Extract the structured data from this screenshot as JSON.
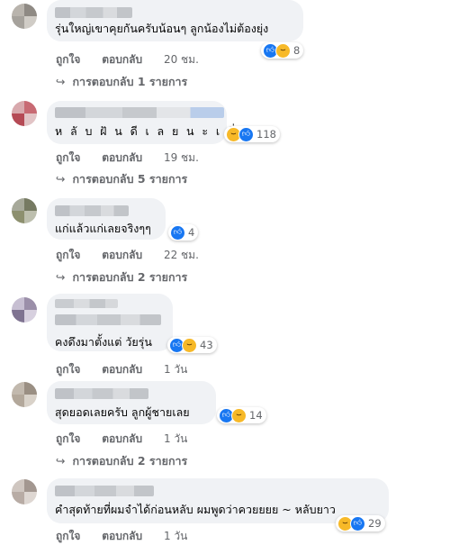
{
  "comments": [
    {
      "text": "รุ่นใหญ่เขาคุยกันครับน้อนๆ ลูกน้องไม่ต้องยุ่ง",
      "reaction_count": "8",
      "reactions": [
        "like-icon",
        "haha-icon"
      ],
      "like_label": "ถูกใจ",
      "reply_label": "ตอบกลับ",
      "time": "20 ชม.",
      "replies_label": "การตอบกลับ 1 รายการ",
      "reply_arrow": "↪"
    },
    {
      "text": "ห ลั บ ฝั น ดี เ ล ย น ะ เ นี่ ย",
      "reaction_count": "118",
      "reactions": [
        "haha-icon",
        "like-icon"
      ],
      "like_label": "ถูกใจ",
      "reply_label": "ตอบกลับ",
      "time": "19 ชม.",
      "replies_label": "การตอบกลับ 5 รายการ",
      "reply_arrow": "↪"
    },
    {
      "text": "แก่แล้วแก่เลยจริงๆๆ",
      "reaction_count": "4",
      "reactions": [
        "like-icon"
      ],
      "like_label": "ถูกใจ",
      "reply_label": "ตอบกลับ",
      "time": "22 ชม.",
      "replies_label": "การตอบกลับ 2 รายการ",
      "reply_arrow": "↪"
    },
    {
      "text": "คงดึงมาตั้งแต่ วัยรุ่น",
      "reaction_count": "43",
      "reactions": [
        "like-icon",
        "haha-icon"
      ],
      "like_label": "ถูกใจ",
      "reply_label": "ตอบกลับ",
      "time": "1 วัน"
    },
    {
      "text": "สุดยอดเลยครับ ลูกผู้ชายเลย",
      "reaction_count": "14",
      "reactions": [
        "like-icon",
        "haha-icon"
      ],
      "like_label": "ถูกใจ",
      "reply_label": "ตอบกลับ",
      "time": "1 วัน",
      "replies_label": "การตอบกลับ 2 รายการ",
      "reply_arrow": "↪"
    },
    {
      "text": "คำสุดท้ายที่ผมจำได้ก่อนหลับ ผมพูดว่าควยยยย ~ หลับยาว",
      "reaction_count": "29",
      "reactions": [
        "haha-icon",
        "like-icon"
      ],
      "like_label": "ถูกใจ",
      "reply_label": "ตอบกลับ",
      "time": "1 วัน"
    }
  ],
  "icons": {
    "like": "like-icon",
    "haha": "haha-icon",
    "reply_arrow": "reply-arrow-icon"
  },
  "colors": {
    "like": "#1877f2",
    "haha": "#f7b928",
    "bubble": "#f0f2f5",
    "meta": "#65676b"
  }
}
